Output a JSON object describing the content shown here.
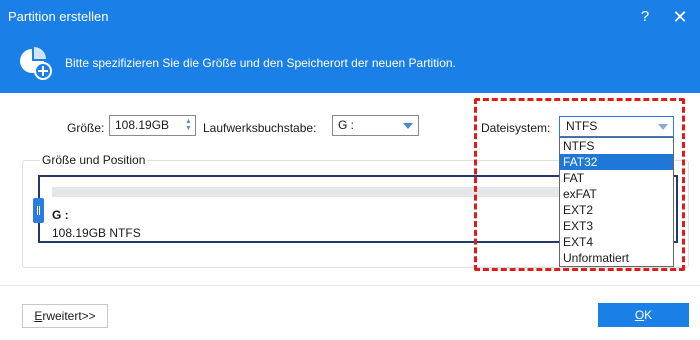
{
  "window": {
    "title": "Partition erstellen",
    "help_label": "?",
    "close_label": "✕"
  },
  "banner": {
    "icon": "partition-add-icon",
    "text": "Bitte spezifizieren Sie die Größe und den Speicherort der neuen Partition."
  },
  "form": {
    "size_label": "Größe:",
    "size_value": "108.19GB",
    "drive_letter_label": "Laufwerksbuchstabe:",
    "drive_letter_value": "G :",
    "filesystem_label": "Dateisystem:",
    "filesystem_value": "NTFS"
  },
  "filesystem_options": [
    "NTFS",
    "FAT32",
    "FAT",
    "exFAT",
    "EXT2",
    "EXT3",
    "EXT4",
    "Unformatiert"
  ],
  "filesystem_highlighted": "FAT32",
  "position": {
    "group_title": "Größe und Position",
    "partition_name": "G :",
    "partition_info": "108.19GB NTFS"
  },
  "buttons": {
    "advanced_first": "E",
    "advanced_rest": "rweitert>>",
    "ok_first": "O",
    "ok_rest": "K"
  },
  "colors": {
    "brand_blue": "#1a7fe6",
    "highlight_red": "#e11b1b",
    "selected_blue": "#1f78d8"
  }
}
